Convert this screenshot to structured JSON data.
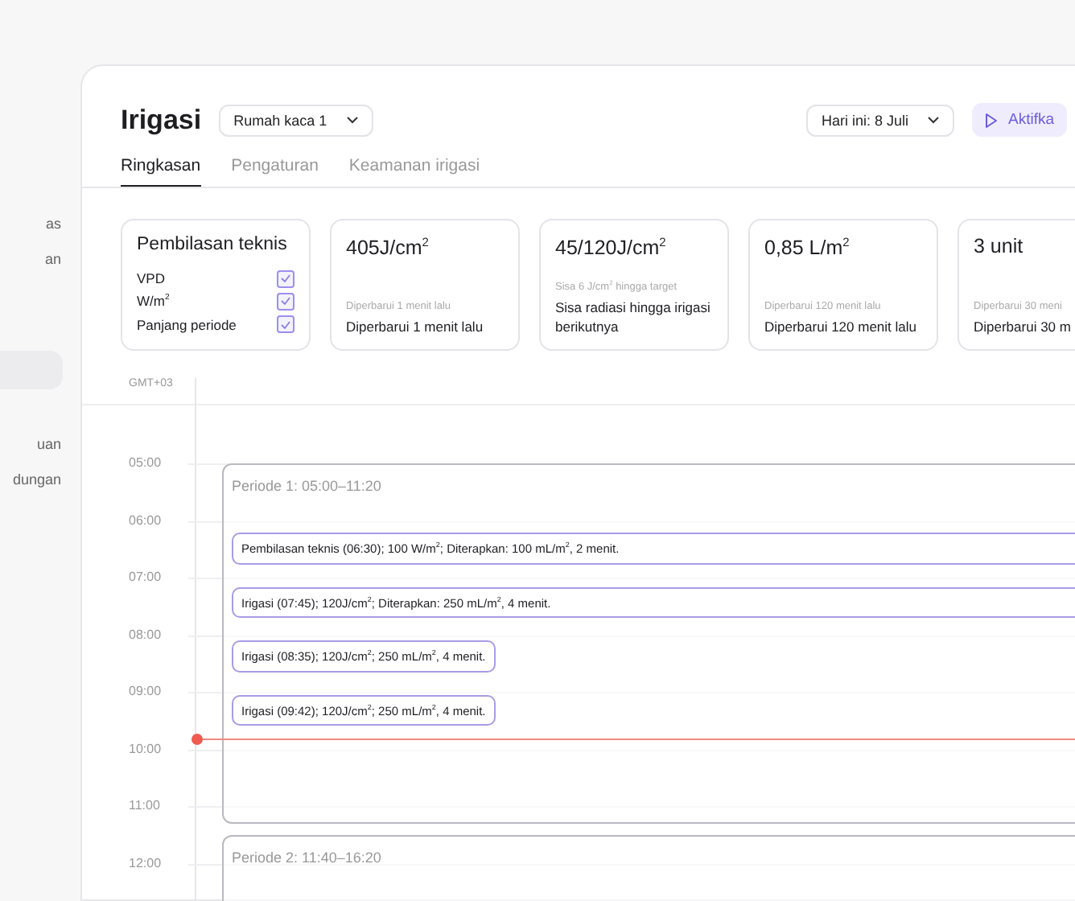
{
  "sidebar": {
    "items": [
      {
        "label": "as",
        "selected": false
      },
      {
        "label": "an",
        "selected": false
      },
      {
        "selected": true
      },
      {
        "label": "uan",
        "selected": false
      },
      {
        "label": "dungan",
        "selected": false
      }
    ]
  },
  "header": {
    "title": "Irigasi",
    "location_dropdown": "Rumah kaca 1",
    "date_dropdown": "Hari ini: 8 Juli",
    "activate_button": "Aktifka"
  },
  "tabs": [
    {
      "label": "Ringkasan",
      "selected": true
    },
    {
      "label": "Pengaturan",
      "selected": false
    },
    {
      "label": "Keamanan irigasi",
      "selected": false
    }
  ],
  "cards": [
    {
      "kind": "checklist",
      "title": "Pembilasan teknis",
      "items": [
        {
          "label": "VPD",
          "checked": true
        },
        {
          "label": "W/m$^{2}$",
          "checked": true
        },
        {
          "label": "Panjang periode",
          "checked": true
        }
      ]
    },
    {
      "kind": "metric",
      "value": "405J/cm$^{2}$",
      "sub": "Diperbarui 1 menit lalu",
      "note": "Diperbarui 1 menit lalu"
    },
    {
      "kind": "metric",
      "value": "45/120J/cm$^{2}$",
      "sub": "Sisa 6 J/cm$^{2}$ hingga target",
      "note": "Sisa radiasi hingga irigasi berikutnya"
    },
    {
      "kind": "metric",
      "value": "0,85 L/m$^{2}$",
      "sub": "Diperbarui 120 menit lalu",
      "note": "Diperbarui 120 menit lalu"
    },
    {
      "kind": "metric",
      "value": "3 unit",
      "sub": "Diperbarui 30 meni",
      "note": "Diperbarui 30 m"
    }
  ],
  "timeline": {
    "timezone": "GMT+03",
    "hours": [
      "05:00",
      "06:00",
      "07:00",
      "08:00",
      "09:00",
      "10:00",
      "11:00",
      "12:00"
    ],
    "periods": [
      {
        "title": "Periode 1: 05:00–11:20",
        "events": [
          {
            "kind": "applied",
            "text": "Pembilasan teknis (06:30); 100 W/m$^{2}$; Diterapkan: 100 mL/m$^{2}$, 2 menit."
          },
          {
            "kind": "applied",
            "text": "Irigasi (07:45); 120J/cm$^{2}$; Diterapkan: 250 mL/m$^{2}$, 4 menit."
          },
          {
            "kind": "planned",
            "text": "Irigasi (08:35); 120J/cm$^{2}$; 250 mL/m$^{2}$, 4 menit."
          },
          {
            "kind": "planned",
            "text": "Irigasi (09:42); 120J/cm$^{2}$; 250 mL/m$^{2}$, 4 menit."
          }
        ]
      },
      {
        "title": "Periode 2: 11:40–16:20"
      }
    ]
  }
}
